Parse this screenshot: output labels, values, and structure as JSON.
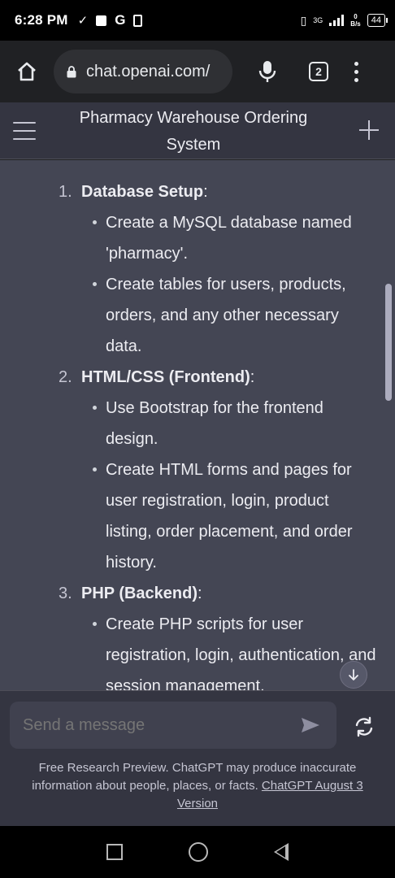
{
  "status_bar": {
    "time": "6:28 PM",
    "network": "3G",
    "data_rate": "0",
    "data_unit": "B/s",
    "battery": "44"
  },
  "browser": {
    "url": "chat.openai.com/",
    "tab_count": "2"
  },
  "header": {
    "title": "Pharmacy Warehouse Ordering System"
  },
  "content": {
    "items": [
      {
        "number": "1.",
        "title": "Database Setup",
        "suffix": ":",
        "bullets": [
          "Create a MySQL database named 'pharmacy'.",
          "Create tables for users, products, orders, and any other necessary data."
        ]
      },
      {
        "number": "2.",
        "title": "HTML/CSS (Frontend)",
        "suffix": ":",
        "bullets": [
          "Use Bootstrap for the frontend design.",
          "Create HTML forms and pages for user registration, login, product listing, order placement, and order history."
        ]
      },
      {
        "number": "3.",
        "title": "PHP (Backend)",
        "suffix": ":",
        "bullets": [
          "Create PHP scripts for user registration, login, authentication, and session management."
        ]
      }
    ]
  },
  "composer": {
    "placeholder": "Send a message"
  },
  "footer": {
    "disclaimer": "Free Research Preview. ChatGPT may produce inaccurate information about people, places, or facts. ",
    "link": "ChatGPT August 3 Version"
  },
  "colors": {
    "content_bg": "#444654",
    "header_bg": "#343541",
    "browser_bg": "#202124"
  }
}
